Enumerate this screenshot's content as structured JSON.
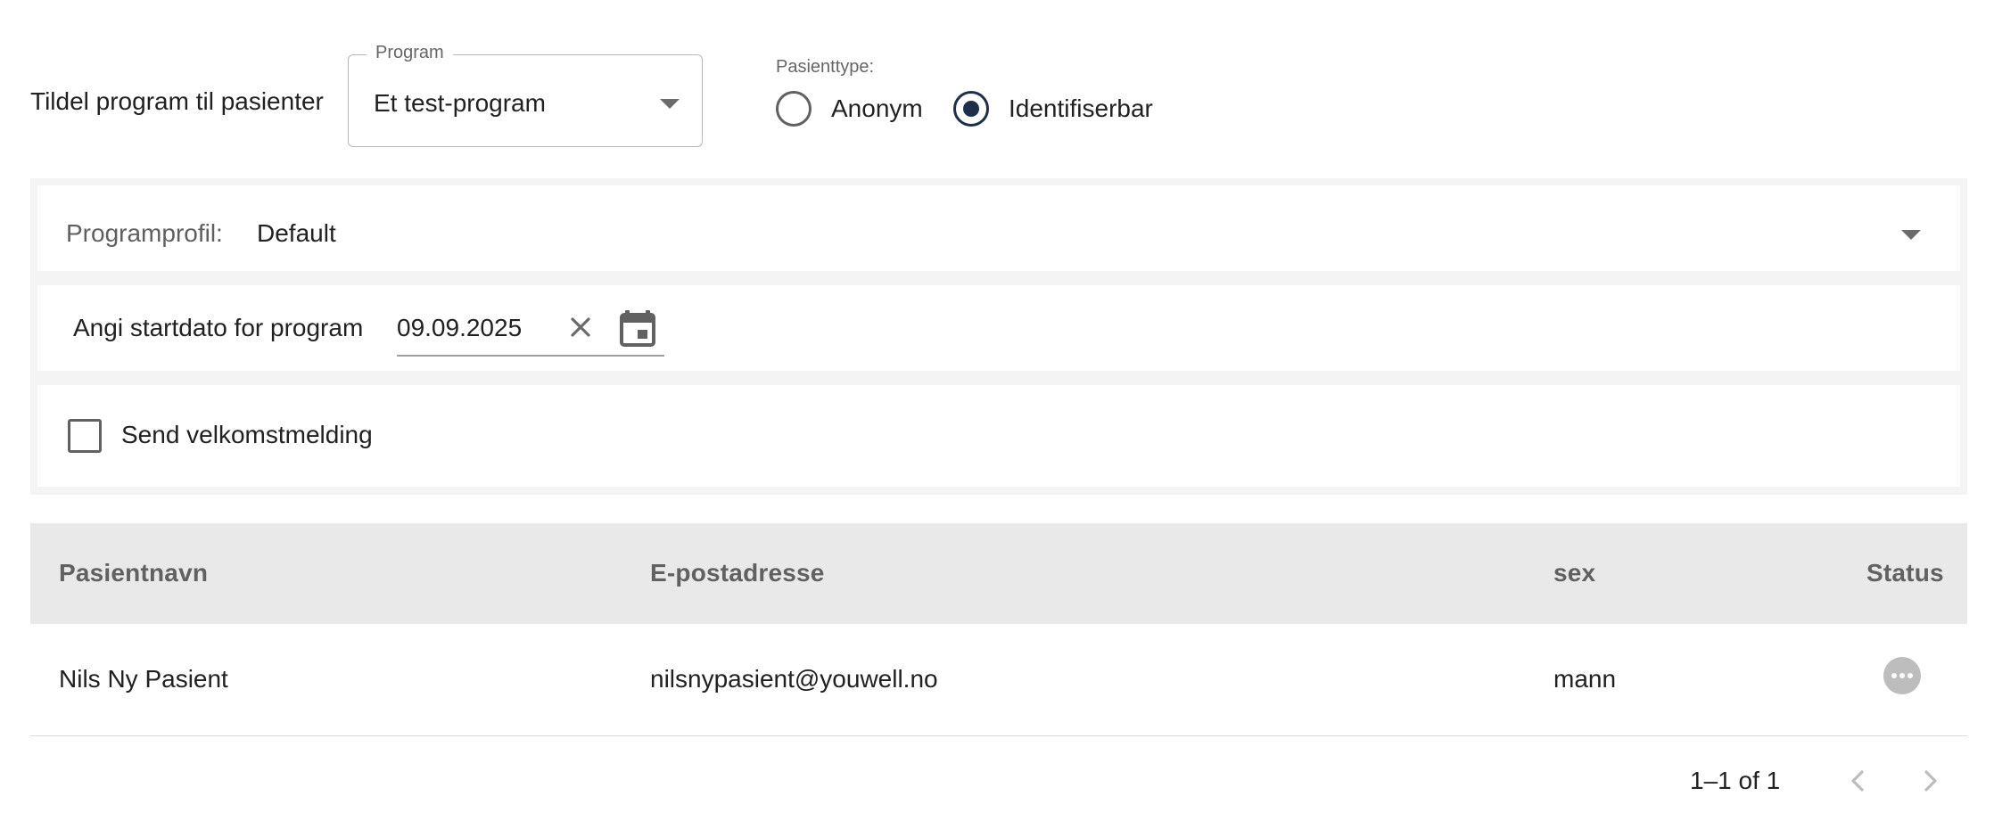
{
  "assign": {
    "label": "Tildel program til pasienter",
    "program_legend": "Program",
    "program_value": "Et test-program"
  },
  "patient_type": {
    "label": "Pasienttype:",
    "options": [
      {
        "label": "Anonym",
        "selected": false
      },
      {
        "label": "Identifiserbar",
        "selected": true
      }
    ]
  },
  "settings": {
    "profile_label": "Programprofil:",
    "profile_value": "Default",
    "startdate_label": "Angi startdato for program",
    "startdate_value": "09.09.2025",
    "welcome_label": "Send velkomstmelding",
    "welcome_checked": false
  },
  "table": {
    "columns": [
      "Pasientnavn",
      "E-postadresse",
      "sex",
      "Status"
    ],
    "rows": [
      {
        "name": "Nils Ny Pasient",
        "email": "nilsnypasient@youwell.no",
        "sex": "mann",
        "status_icon": "more-horizontal-icon"
      }
    ]
  },
  "pagination": {
    "range": "1–1 of 1"
  },
  "icons": {
    "select_caret": "caret-down-icon",
    "clear": "close-icon",
    "calendar": "calendar-icon",
    "prev": "chevron-left-icon",
    "next": "chevron-right-icon"
  },
  "colors": {
    "accent": "#1e2f4c",
    "panel_bg": "#f4f4f4",
    "table_header_bg": "#e9e9e9"
  }
}
